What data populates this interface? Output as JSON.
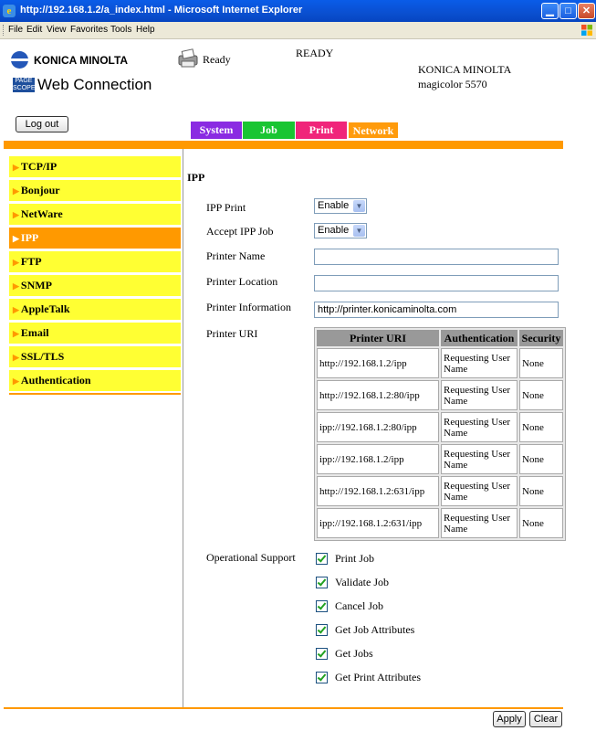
{
  "window": {
    "title": "http://192.168.1.2/a_index.html - Microsoft Internet Explorer",
    "buttons": [
      "minimize",
      "maximize",
      "close"
    ]
  },
  "menu": [
    "File",
    "Edit",
    "View",
    "Favorites",
    "Tools",
    "Help"
  ],
  "header": {
    "brand": "KONICA MINOLTA",
    "product_badge": "PAGE SCOPE",
    "product": "Web Connection",
    "status_icon_text": "Ready",
    "status": "READY",
    "model_vendor": "KONICA MINOLTA",
    "model_name": "magicolor 5570",
    "logout": "Log out"
  },
  "tabs": [
    {
      "label": "System",
      "color": "#8a2be2"
    },
    {
      "label": "Job",
      "color": "#19c532"
    },
    {
      "label": "Print",
      "color": "#f0257a"
    },
    {
      "label": "Network",
      "color": "#ff9b0c",
      "active": true
    }
  ],
  "sidebar": {
    "items": [
      "TCP/IP",
      "Bonjour",
      "NetWare",
      "IPP",
      "FTP",
      "SNMP",
      "AppleTalk",
      "Email",
      "SSL/TLS",
      "Authentication"
    ],
    "active": "IPP"
  },
  "form": {
    "heading": "IPP",
    "ipp_print_label": "IPP Print",
    "ipp_print_value": "Enable",
    "accept_ipp_job_label": "Accept IPP Job",
    "accept_ipp_job_value": "Enable",
    "printer_name_label": "Printer Name",
    "printer_name_value": "",
    "printer_location_label": "Printer Location",
    "printer_location_value": "",
    "printer_information_label": "Printer Information",
    "printer_information_value": "http://printer.konicaminolta.com",
    "printer_uri_label": "Printer URI",
    "uri_table": {
      "headers": [
        "Printer URI",
        "Authentication",
        "Security"
      ],
      "rows": [
        [
          "http://192.168.1.2/ipp",
          "Requesting User Name",
          "None"
        ],
        [
          "http://192.168.1.2:80/ipp",
          "Requesting User Name",
          "None"
        ],
        [
          "ipp://192.168.1.2:80/ipp",
          "Requesting User Name",
          "None"
        ],
        [
          "ipp://192.168.1.2/ipp",
          "Requesting User Name",
          "None"
        ],
        [
          "http://192.168.1.2:631/ipp",
          "Requesting User Name",
          "None"
        ],
        [
          "ipp://192.168.1.2:631/ipp",
          "Requesting User Name",
          "None"
        ]
      ]
    },
    "operational_support_label": "Operational Support",
    "operations": [
      {
        "label": "Print Job",
        "checked": true
      },
      {
        "label": "Validate Job",
        "checked": true
      },
      {
        "label": "Cancel Job",
        "checked": true
      },
      {
        "label": "Get Job Attributes",
        "checked": true
      },
      {
        "label": "Get Jobs",
        "checked": true
      },
      {
        "label": "Get Print Attributes",
        "checked": true
      }
    ]
  },
  "footer": {
    "apply": "Apply",
    "clear": "Clear"
  }
}
